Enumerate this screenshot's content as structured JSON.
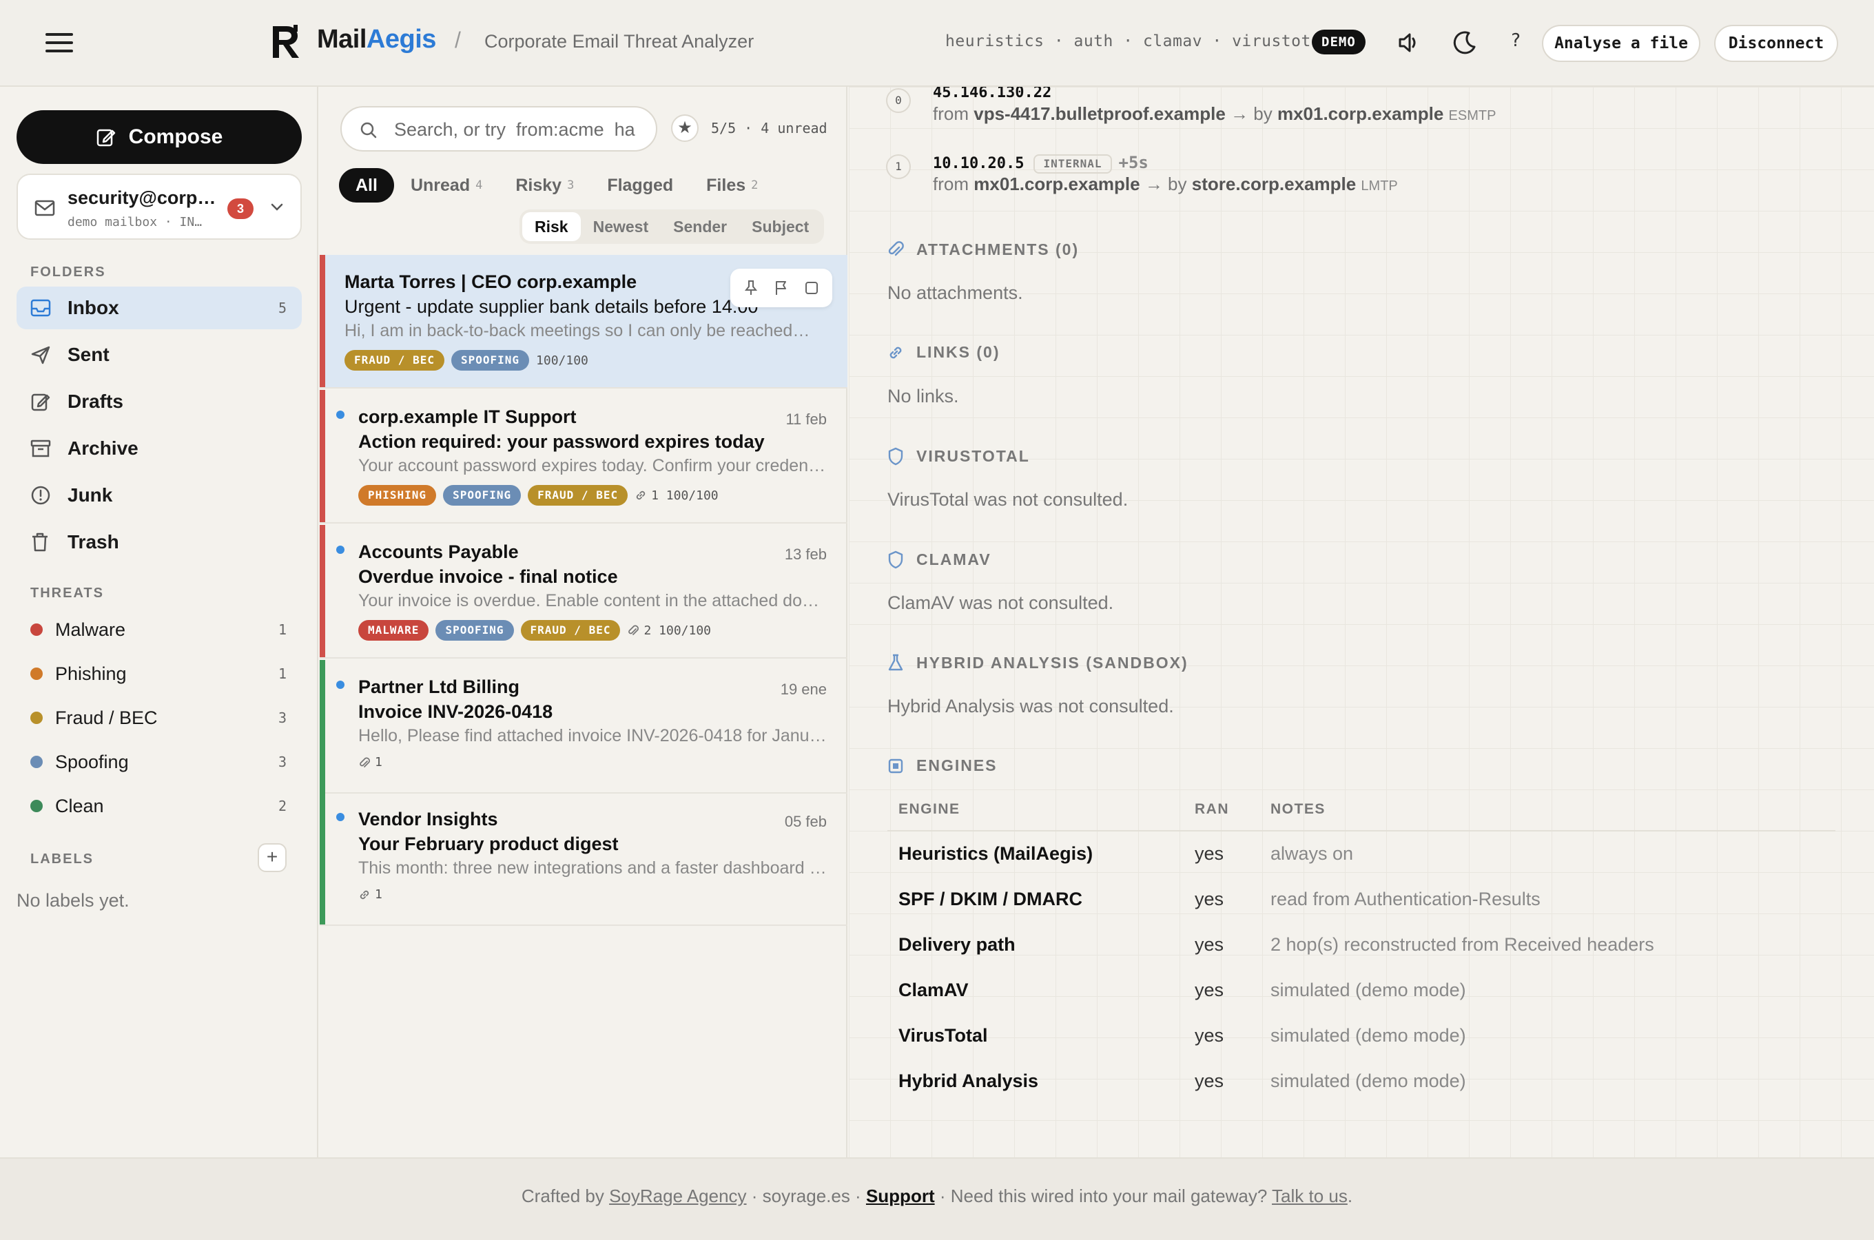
{
  "header": {
    "brand_a": "Mail",
    "brand_b": "Aegis",
    "crumb_sep": "/",
    "subtitle": "Corporate Email Threat Analyzer",
    "engines": "heuristics · auth · clamav · virustotal",
    "demo": "DEMO",
    "help": "?",
    "analyse_label": "Analyse a file",
    "disconnect_label": "Disconnect"
  },
  "sidebar": {
    "compose_label": "Compose",
    "account": {
      "name": "security@corp…",
      "sub": "demo mailbox · IN…",
      "badge": "3"
    },
    "folders_title": "FOLDERS",
    "folders": [
      {
        "label": "Inbox",
        "count": "5",
        "icon": "inbox-icon"
      },
      {
        "label": "Sent",
        "count": "",
        "icon": "send-icon"
      },
      {
        "label": "Drafts",
        "count": "",
        "icon": "edit-icon"
      },
      {
        "label": "Archive",
        "count": "",
        "icon": "archive-icon"
      },
      {
        "label": "Junk",
        "count": "",
        "icon": "alert-circle-icon"
      },
      {
        "label": "Trash",
        "count": "",
        "icon": "trash-icon"
      }
    ],
    "threats_title": "THREATS",
    "threats": [
      {
        "label": "Malware",
        "count": "1",
        "color": "#c8463d"
      },
      {
        "label": "Phishing",
        "count": "1",
        "color": "#d07a2a"
      },
      {
        "label": "Fraud / BEC",
        "count": "3",
        "color": "#b8902a"
      },
      {
        "label": "Spoofing",
        "count": "3",
        "color": "#6b8db5"
      },
      {
        "label": "Clean",
        "count": "2",
        "color": "#3d8a5a"
      }
    ],
    "labels_title": "LABELS",
    "no_labels": "No labels yet."
  },
  "list": {
    "search_placeholder": "Search, or try  from:acme  ha",
    "count_info": "5/5 · 4 unread",
    "filter_tabs": [
      {
        "label": "All",
        "n": ""
      },
      {
        "label": "Unread",
        "n": "4"
      },
      {
        "label": "Risky",
        "n": "3"
      },
      {
        "label": "Flagged",
        "n": ""
      },
      {
        "label": "Files",
        "n": "2"
      }
    ],
    "sort_tabs": [
      "Risk",
      "Newest",
      "Sender",
      "Subject"
    ],
    "messages": [
      {
        "from": "Marta Torres | CEO corp.example",
        "date": "",
        "subject": "Urgent - update supplier bank details before 14:00",
        "preview": "Hi, I am in back-to-back meetings so I can only be reached by email today. Please update",
        "tags": [
          "FRAUD / BEC",
          "SPOOFING"
        ],
        "meta": "100/100"
      },
      {
        "from": "corp.example IT Support",
        "date": "11 feb",
        "subject": "Action required: your password expires today",
        "preview": "Your account password expires today. Confirm your credentials to keep access.",
        "tags": [
          "PHISHING",
          "SPOOFING",
          "FRAUD / BEC"
        ],
        "meta": "1 100/100"
      },
      {
        "from": "Accounts Payable",
        "date": "13 feb",
        "subject": "Overdue invoice - final notice",
        "preview": "Your invoice is overdue. Enable content in the attached document to view it.",
        "tags": [
          "MALWARE",
          "SPOOFING",
          "FRAUD / BEC"
        ],
        "meta": "2 100/100"
      },
      {
        "from": "Partner Ltd Billing",
        "date": "19 ene",
        "subject": "Invoice INV-2026-0418",
        "preview": "Hello, Please find attached invoice INV-2026-0418 for January services.",
        "tags": [],
        "meta": "1"
      },
      {
        "from": "Vendor Insights",
        "date": "05 feb",
        "subject": "Your February product digest",
        "preview": "This month: three new integrations and a faster dashboard experience for all teams.",
        "tags": [],
        "meta": "1"
      }
    ]
  },
  "detail": {
    "hops": [
      {
        "idx": "0",
        "ip": "45.146.130.22",
        "from": "vps-4417.bulletproof.example",
        "by": "mx01.corp.example",
        "proto": "ESMTP",
        "internal": "",
        "delay": ""
      },
      {
        "idx": "1",
        "ip": "10.10.20.5",
        "from": "mx01.corp.example",
        "by": "store.corp.example",
        "proto": "LMTP",
        "internal": "INTERNAL",
        "delay": "+5s"
      }
    ],
    "from_word": "from",
    "by_word": "→ by",
    "sections": [
      {
        "title": "ATTACHMENTS (0)",
        "text": "No attachments."
      },
      {
        "title": "LINKS (0)",
        "text": "No links."
      },
      {
        "title": "VIRUSTOTAL",
        "text": "VirusTotal was not consulted."
      },
      {
        "title": "CLAMAV",
        "text": "ClamAV was not consulted."
      },
      {
        "title": "HYBRID ANALYSIS (SANDBOX)",
        "text": "Hybrid Analysis was not consulted."
      }
    ],
    "engines_title": "ENGINES",
    "engines_cols": [
      "ENGINE",
      "RAN",
      "NOTES"
    ],
    "engines": [
      {
        "name": "Heuristics (MailAegis)",
        "ran": "yes",
        "notes": "always on"
      },
      {
        "name": "SPF / DKIM / DMARC",
        "ran": "yes",
        "notes": "read from Authentication-Results"
      },
      {
        "name": "Delivery path",
        "ran": "yes",
        "notes": "2 hop(s) reconstructed from Received headers"
      },
      {
        "name": "ClamAV",
        "ran": "yes",
        "notes": "simulated (demo mode)"
      },
      {
        "name": "VirusTotal",
        "ran": "yes",
        "notes": "simulated (demo mode)"
      },
      {
        "name": "Hybrid Analysis",
        "ran": "yes",
        "notes": "simulated (demo mode)"
      }
    ]
  },
  "footer": {
    "crafted": "Crafted by",
    "agency": "SoyRage Agency",
    "site": " · soyrage.es · ",
    "support": "Support",
    "question": " · Need this wired into your mail gateway? ",
    "talk": "Talk to us",
    "end": "."
  },
  "colors": {
    "accent": "#2d7bd6",
    "selected_bg": "#dce7f3",
    "risk_red": "#d0504a",
    "clean_green": "#3d9a5a"
  }
}
